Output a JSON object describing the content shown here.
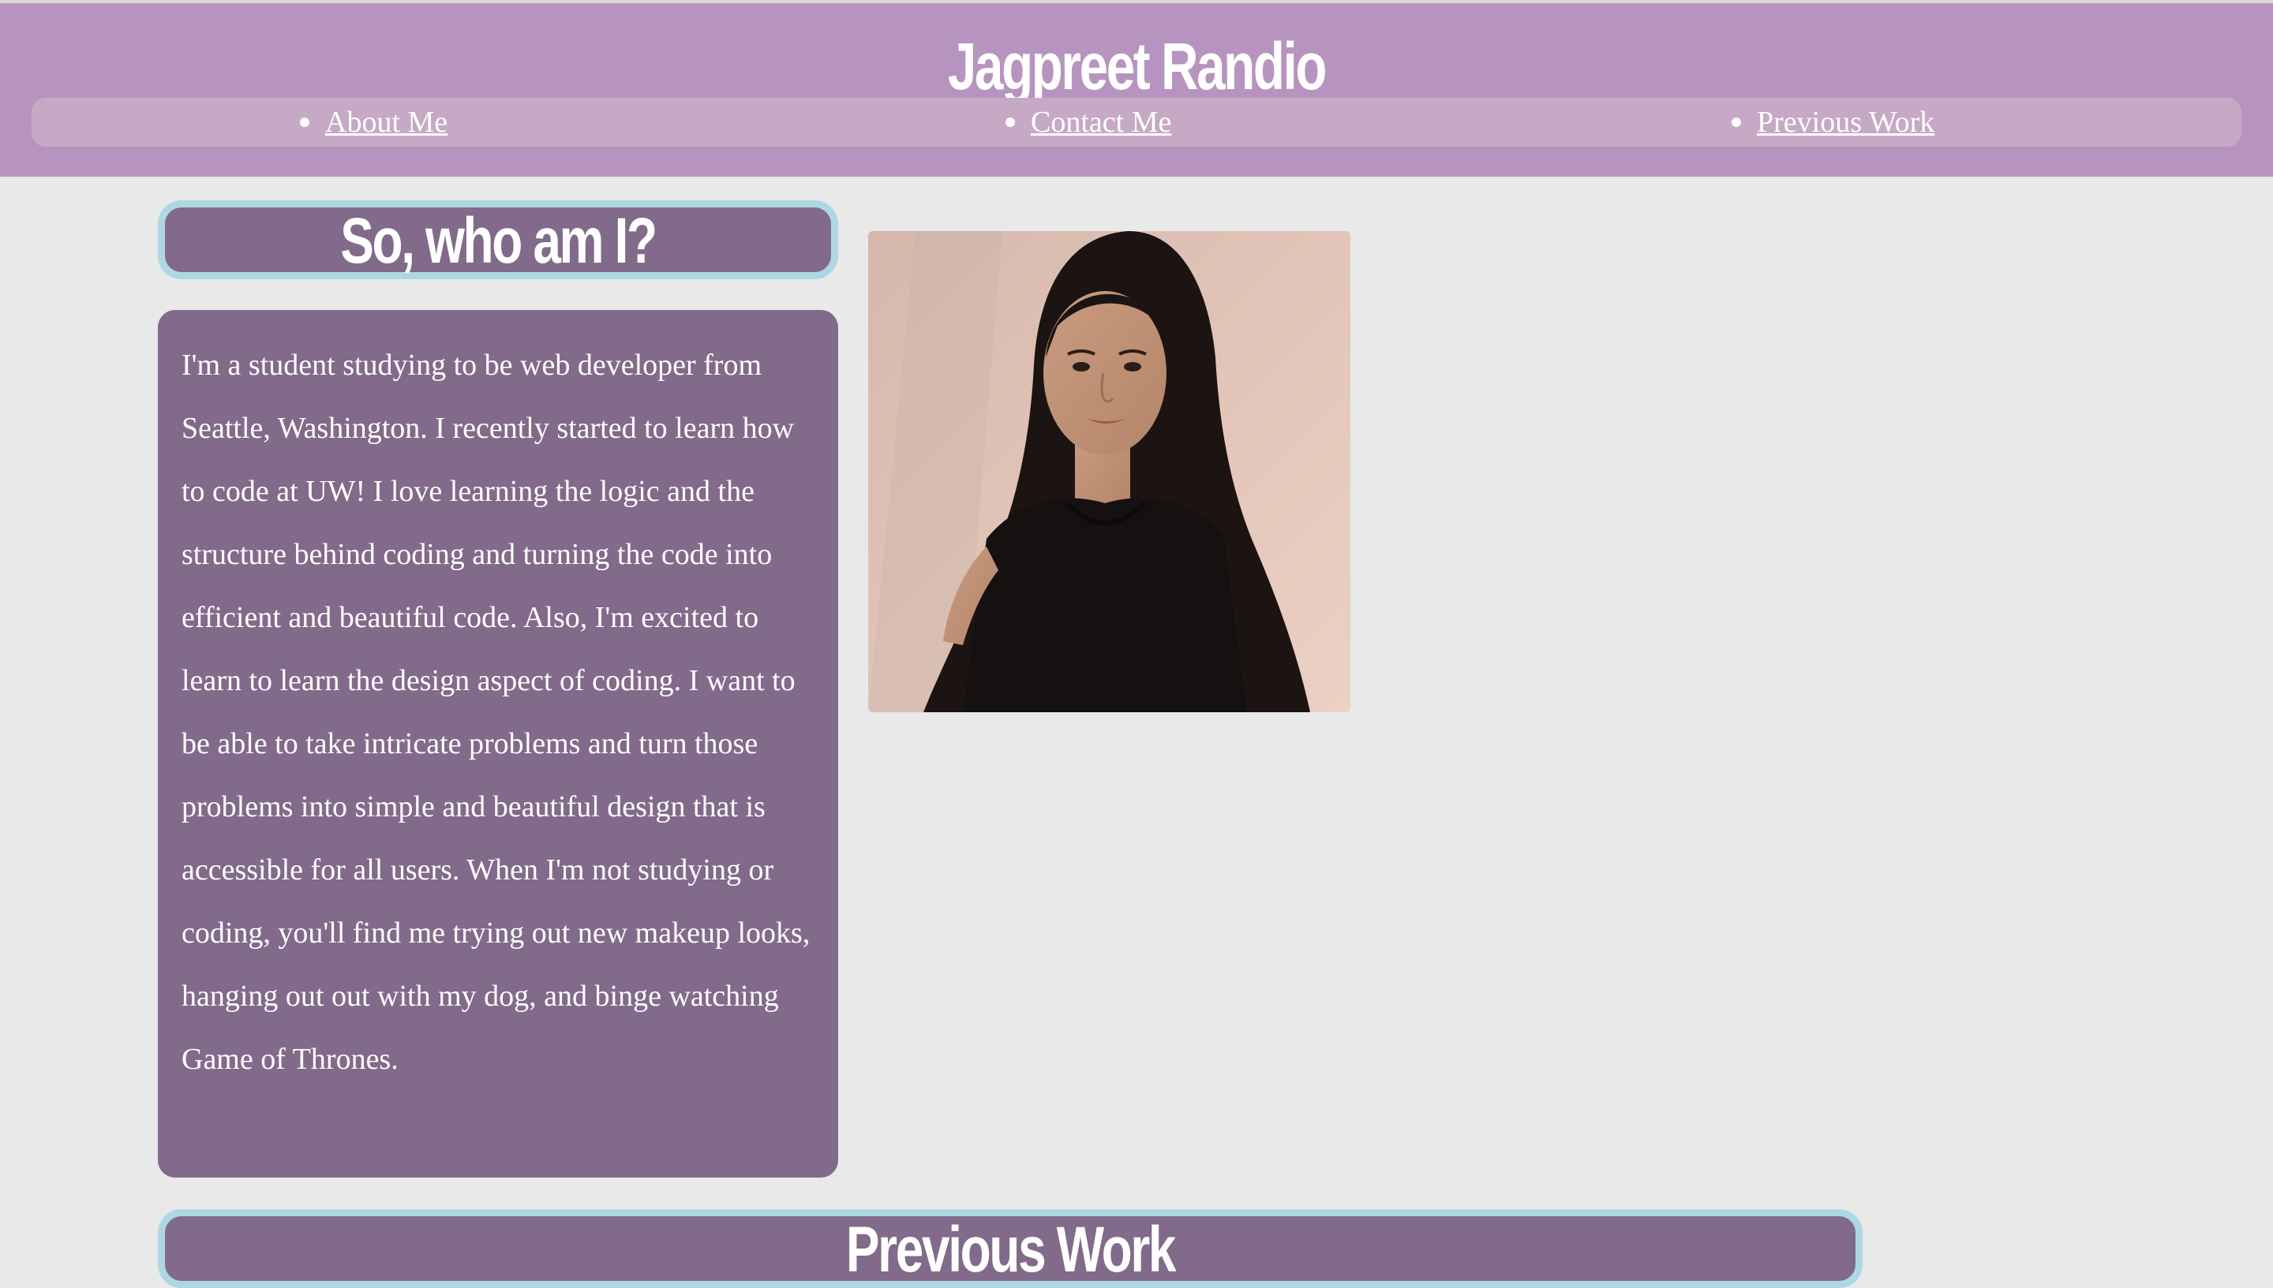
{
  "header": {
    "site_title": "Jagpreet Randio",
    "nav": [
      {
        "label": "About Me"
      },
      {
        "label": "Contact Me"
      },
      {
        "label": "Previous Work"
      }
    ]
  },
  "about": {
    "heading": "So, who am I?",
    "bio": "I'm a student studying to be web developer from Seattle, Washington. I recently started to learn how to code at UW! I love learning the logic and the structure behind coding and turning the code into efficient and beautiful code. Also, I'm excited to learn to learn the design aspect of coding. I want to be able to take intricate problems and turn those problems into simple and beautiful design that is accessible for all users. When I'm not studying or coding, you'll find me trying out new makeup looks, hanging out out with my dog, and binge watching Game of Thrones."
  },
  "previous_work": {
    "heading": "Previous Work"
  },
  "colors": {
    "header_bg": "#b794c0",
    "nav_bg": "#c6a9c4",
    "card_bg": "#826a8a",
    "card_border": "#add8e3",
    "page_bg": "#e9e9e9"
  }
}
